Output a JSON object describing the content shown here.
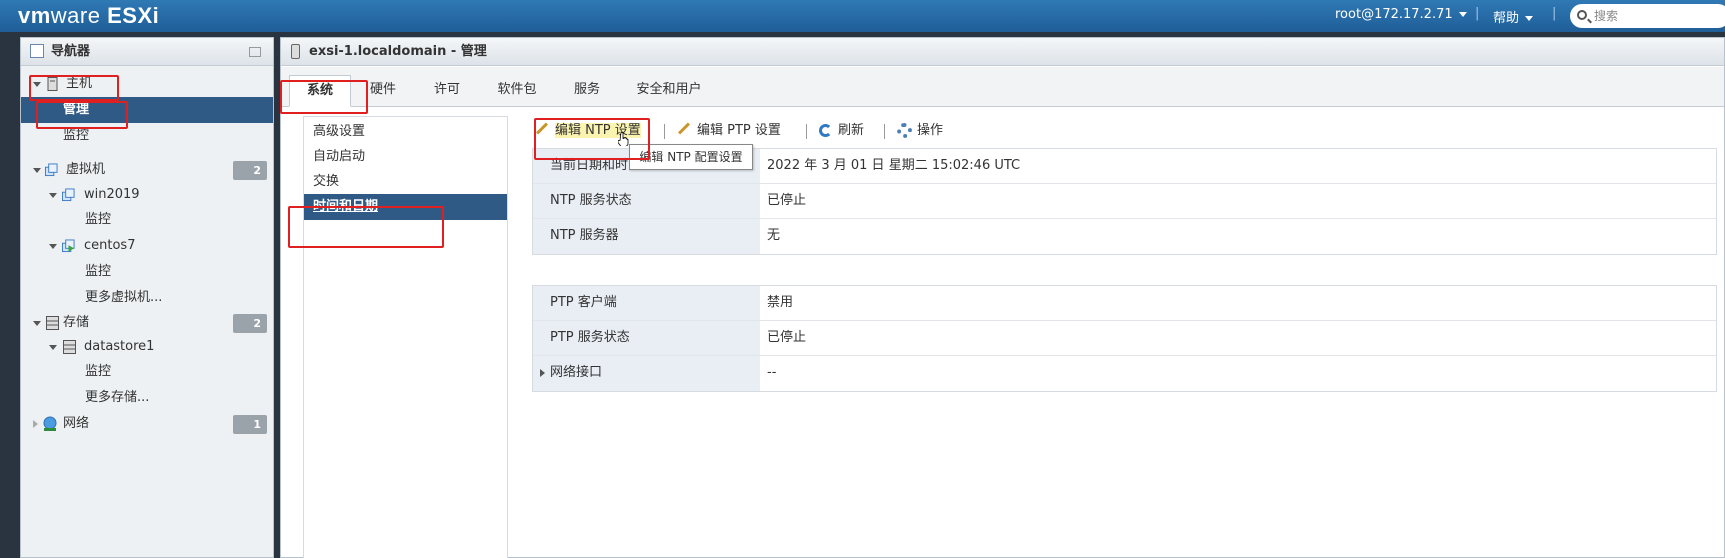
{
  "topbar": {
    "brand": "vm",
    "brand_rest": "ware",
    "product": "ESXi",
    "user": "root@172.17.2.71",
    "help": "帮助",
    "search_placeholder": "搜索"
  },
  "navigator": {
    "title": "导航器",
    "host": "主机",
    "host_manage": "管理",
    "host_monitor": "监控",
    "vms": {
      "label": "虚拟机",
      "count": "2"
    },
    "vm1": {
      "name": "win2019",
      "monitor": "监控"
    },
    "vm2": {
      "name": "centos7",
      "monitor": "监控"
    },
    "more_vms": "更多虚拟机...",
    "storage": {
      "label": "存储",
      "count": "2"
    },
    "datastore": {
      "name": "datastore1",
      "monitor": "监控"
    },
    "more_storage": "更多存储...",
    "network": {
      "label": "网络",
      "count": "1"
    }
  },
  "main": {
    "title": "exsi-1.localdomain - 管理",
    "tabs": [
      "系统",
      "硬件",
      "许可",
      "软件包",
      "服务",
      "安全和用户"
    ],
    "subnav": [
      "高级设置",
      "自动启动",
      "交换",
      "时间和日期"
    ],
    "toolbar": {
      "edit_ntp": "编辑 NTP 设置",
      "edit_ptp": "编辑 PTP 设置",
      "refresh": "刷新",
      "actions": "操作"
    },
    "tooltip": "编辑 NTP 配置设置",
    "ntp_table": [
      {
        "key": "当前日期和时间",
        "value": "2022 年 3 月 01 日 星期二 15:02:46 UTC"
      },
      {
        "key": "NTP 服务状态",
        "value": "已停止"
      },
      {
        "key": "NTP 服务器",
        "value": "无"
      }
    ],
    "ptp_table": [
      {
        "key": "PTP 客户端",
        "value": "禁用"
      },
      {
        "key": "PTP 服务状态",
        "value": "已停止"
      },
      {
        "key": "网络接口",
        "value": "--"
      }
    ]
  },
  "colors": {
    "topbar": "#2769a8",
    "selection": "#2f5a85",
    "annotation": "#e02020"
  }
}
